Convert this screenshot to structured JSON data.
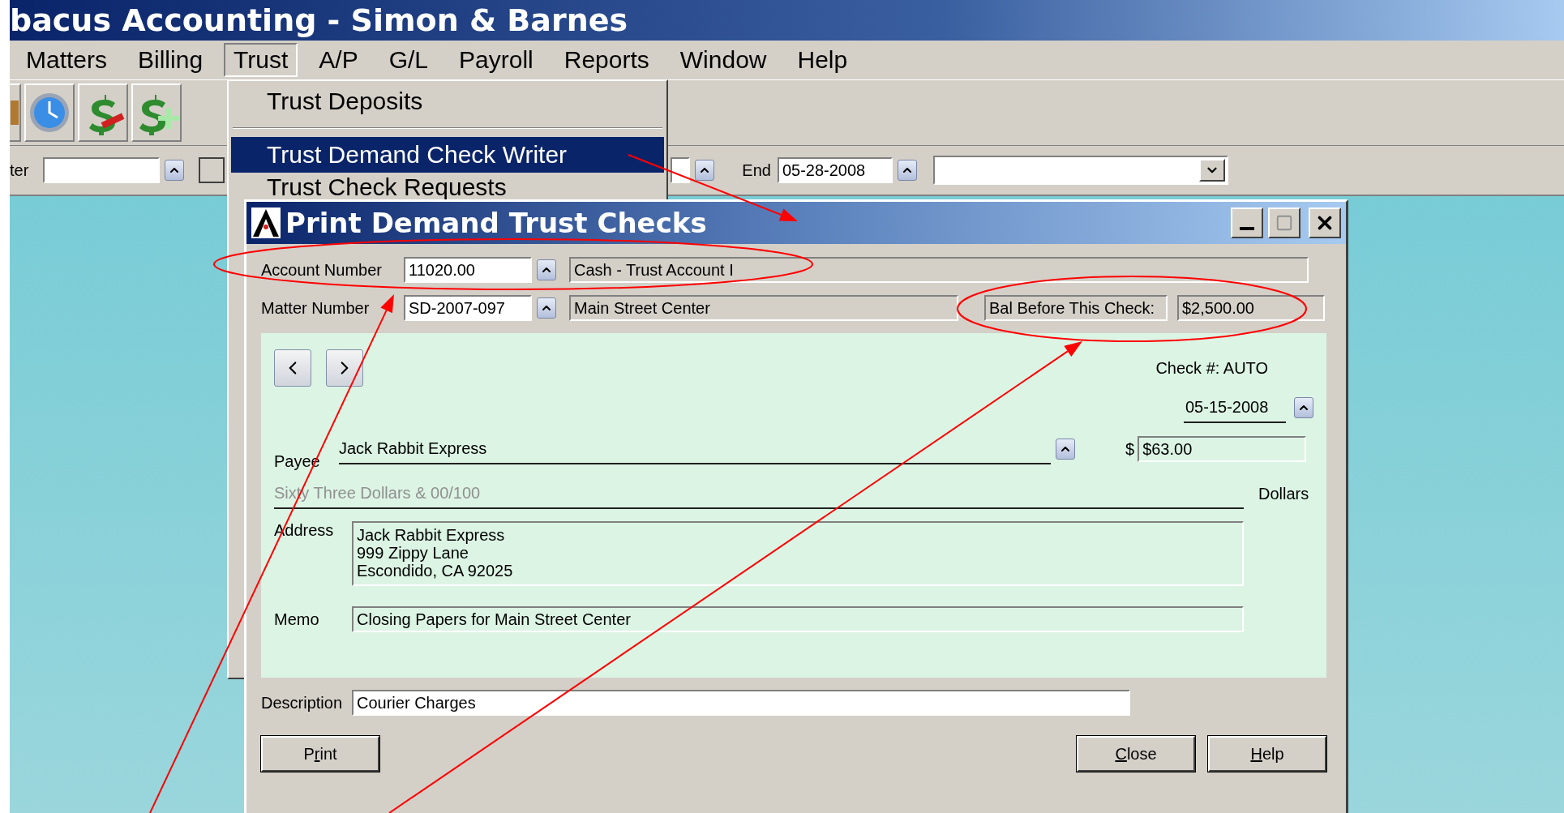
{
  "window": {
    "title": "bacus Accounting - Simon & Barnes"
  },
  "menu_bar": [
    {
      "label": "Matters",
      "selected": false
    },
    {
      "label": "Billing",
      "selected": false
    },
    {
      "label": "Trust",
      "selected": true
    },
    {
      "label": "A/P",
      "selected": false
    },
    {
      "label": "G/L",
      "selected": false
    },
    {
      "label": "Payroll",
      "selected": false
    },
    {
      "label": "Reports",
      "selected": false
    },
    {
      "label": "Window",
      "selected": false
    },
    {
      "label": "Help",
      "selected": false
    }
  ],
  "trust_menu": [
    {
      "kind": "item",
      "label": "Trust Deposits",
      "selected": false
    },
    {
      "kind": "separator"
    },
    {
      "kind": "item",
      "label": "Trust Demand Check Writer",
      "selected": true
    },
    {
      "kind": "item",
      "label": "Trust Check Requests",
      "selected": false
    }
  ],
  "filter_bar": {
    "matter_label": "ter",
    "checked": false,
    "end_label": "End",
    "end_date": "05-28-2008"
  },
  "dialog": {
    "title": "Print Demand Trust Checks",
    "account_label": "Account Number",
    "account_number": "11020.00",
    "account_name": "Cash - Trust Account I",
    "matter_label": "Matter Number",
    "matter_number": "SD-2007-097",
    "matter_name": "Main Street Center",
    "balance_label": "Bal Before This Check:",
    "balance": "$2,500.00",
    "check": {
      "number_label": "Check #: AUTO",
      "date": "05-15-2008",
      "payee_label": "Payee",
      "payee": "Jack Rabbit Express",
      "currency": "$",
      "amount": "$63.00",
      "amount_words": "Sixty Three Dollars & 00/100",
      "dollars_label": "Dollars",
      "address_label": "Address",
      "address": [
        "Jack Rabbit Express",
        "999 Zippy Lane",
        "Escondido, CA 92025"
      ],
      "memo_label": "Memo",
      "memo": "Closing Papers for Main Street Center"
    },
    "description_label": "Description",
    "description": "Courier Charges",
    "buttons": [
      {
        "before": "P",
        "access_key": "r",
        "after": "int"
      },
      {
        "access_key": "C",
        "after": "lose"
      },
      {
        "access_key": "H",
        "after": "elp"
      }
    ]
  }
}
